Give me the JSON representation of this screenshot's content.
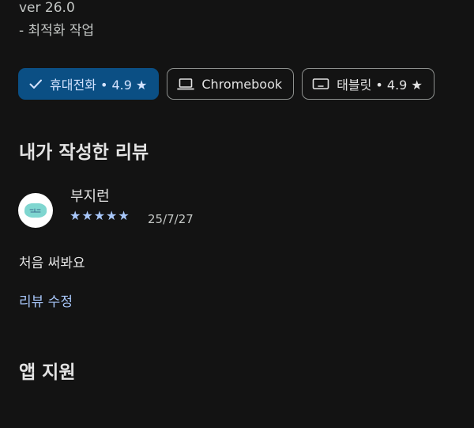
{
  "version_text": "ver 26.0",
  "change_note": "- 최적화 작업",
  "device_chips": [
    {
      "label": "휴대전화 • 4.9 ★",
      "icon": "check-icon",
      "selected": true
    },
    {
      "label": "Chromebook",
      "icon": "laptop-icon",
      "selected": false
    },
    {
      "label": "태블릿 • 4.9 ★",
      "icon": "tablet-icon",
      "selected": false
    }
  ],
  "my_review": {
    "section_title": "내가 작성한 리뷰",
    "reviewer_name": "부지런",
    "stars": "★★★★★",
    "rating": 5,
    "date": "25/7/27",
    "text": "처음 써봐요",
    "edit_label": "리뷰 수정"
  },
  "app_support": {
    "section_title": "앱 지원"
  },
  "colors": {
    "background": "#131313",
    "accent": "#a8c7fa",
    "selected_chip": "#0b4f84"
  }
}
